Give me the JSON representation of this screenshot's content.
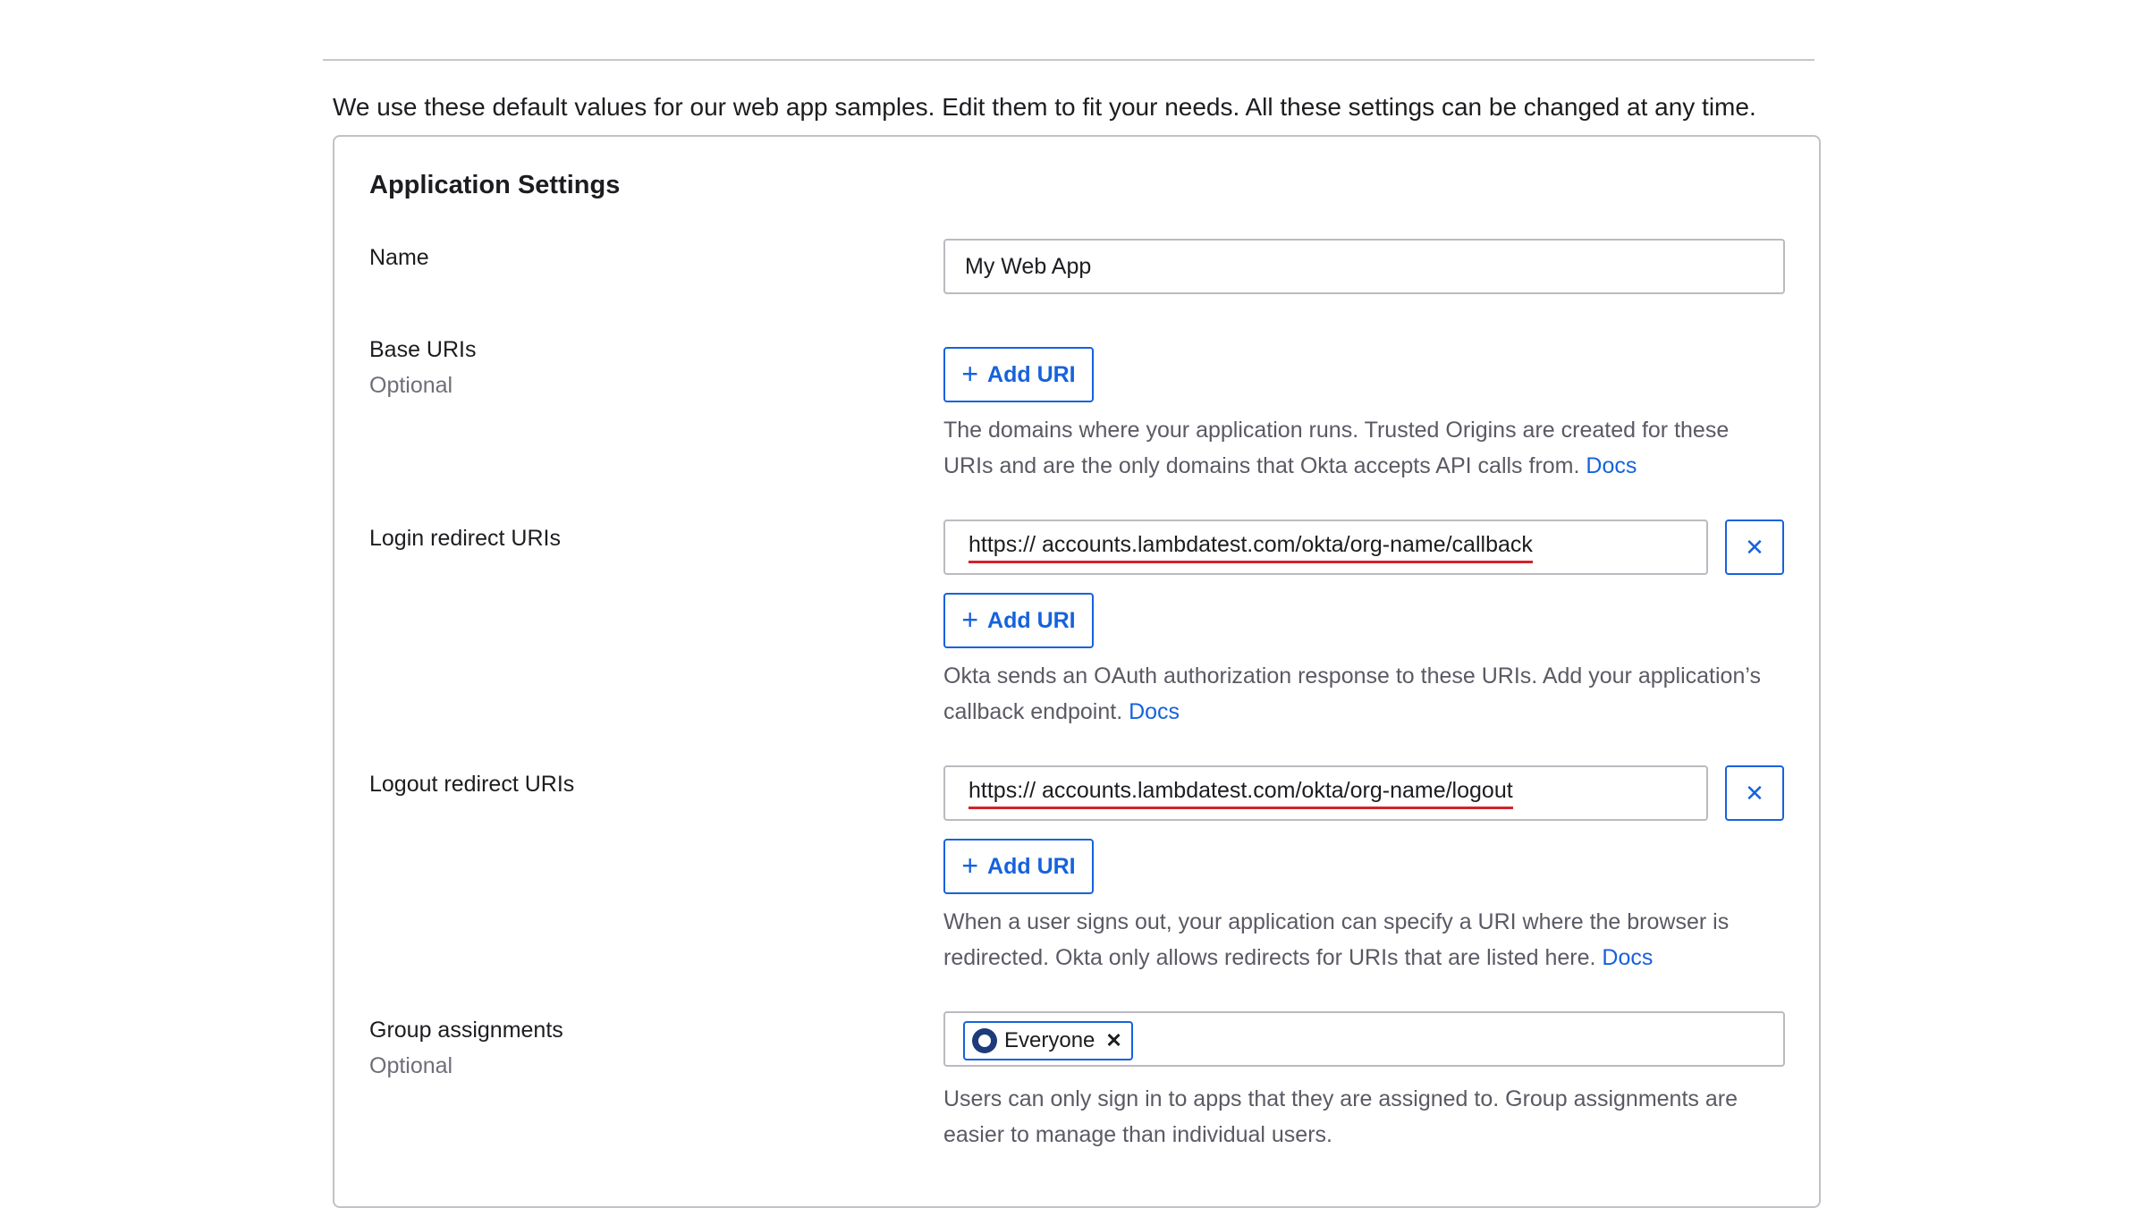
{
  "intro": "We use these default values for our web app samples. Edit them to fit your needs. All these settings can be changed at any time.",
  "card": {
    "title": "Application Settings",
    "name": {
      "label": "Name",
      "value": "My Web App"
    },
    "base_uris": {
      "label": "Base URIs",
      "optional": "Optional",
      "add_label": "Add URI",
      "help": "The domains where your application runs. Trusted Origins are created for these URIs and are the only domains that Okta accepts API calls from.",
      "docs": "Docs"
    },
    "login_redirect": {
      "label": "Login redirect URIs",
      "scheme": "https://",
      "value": "accounts.lambdatest.com/okta/org-name/callback",
      "remove_icon": "close-icon",
      "add_label": "Add URI",
      "help": "Okta sends an OAuth authorization response to these URIs. Add your application’s callback endpoint.",
      "docs": "Docs"
    },
    "logout_redirect": {
      "label": "Logout redirect URIs",
      "scheme": "https://",
      "value": "accounts.lambdatest.com/okta/org-name/logout",
      "remove_icon": "close-icon",
      "add_label": "Add URI",
      "help": "When a user signs out, your application can specify a URI where the browser is redirected. Okta only allows redirects for URIs that are listed here.",
      "docs": "Docs"
    },
    "group_assignments": {
      "label": "Group assignments",
      "optional": "Optional",
      "chip": "Everyone",
      "help": "Users can only sign in to apps that they are assigned to. Group assignments are easier to manage than individual users."
    }
  },
  "colors": {
    "accent": "#1662dd",
    "underline": "#d3232a"
  }
}
